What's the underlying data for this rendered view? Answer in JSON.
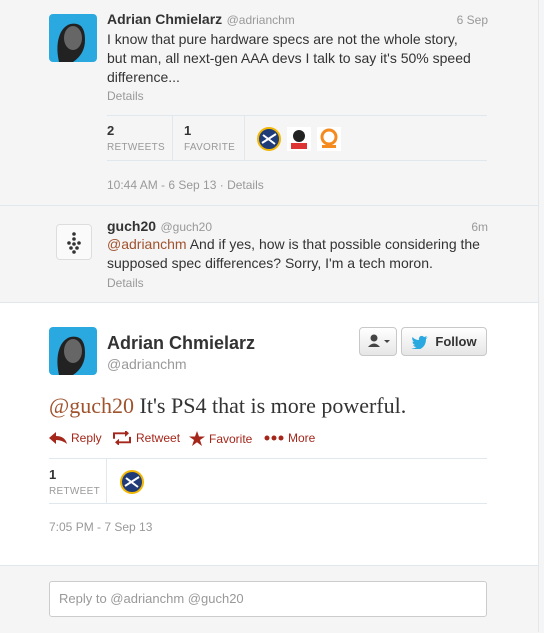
{
  "tweet1": {
    "name": "Adrian Chmielarz",
    "handle": "@adrianchm",
    "date": "6 Sep",
    "text_lines": [
      "I know that pure hardware specs are not the whole story,",
      "but man, all next-gen AAA devs I talk to say it's 50% speed",
      "difference..."
    ],
    "details_label": "Details",
    "retweets_count": "2",
    "retweets_label": "RETWEETS",
    "favorites_count": "1",
    "favorites_label": "FAVORITE",
    "timestamp": "10:44 AM - 6 Sep 13",
    "timestamp_sep": " · ",
    "timestamp_details": "Details"
  },
  "tweet2": {
    "name": "guch20",
    "handle": "@guch20",
    "time": "6m",
    "mention": "@adrianchm",
    "text_rest": " And if yes, how is that possible considering the",
    "text_line2": "supposed spec differences? Sorry, I'm a tech moron.",
    "details_label": "Details"
  },
  "main": {
    "name": "Adrian Chmielarz",
    "handle": "@adrianchm",
    "follow_label": "Follow",
    "mention": "@guch20",
    "text_rest": " It's PS4 that is more powerful.",
    "actions": {
      "reply": "Reply",
      "retweet": "Retweet",
      "favorite": "Favorite",
      "more": "More"
    },
    "retweet_count": "1",
    "retweet_label": "RETWEET",
    "timestamp": "7:05 PM - 7 Sep 13"
  },
  "reply_box": {
    "text": "Reply to @adrianchm @guch20"
  },
  "colors": {
    "accent": "#a5271b",
    "twitter_blue": "#2aa9e0",
    "mention": "#a0522d"
  }
}
